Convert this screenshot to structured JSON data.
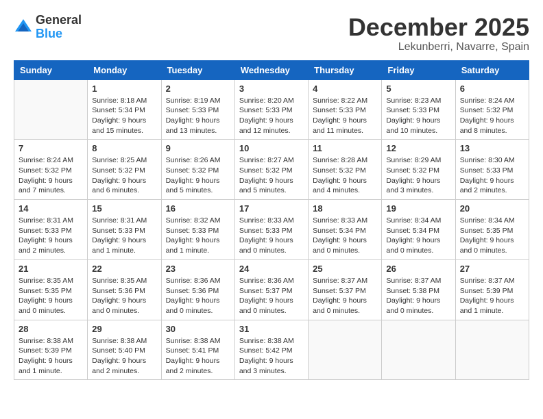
{
  "header": {
    "logo": {
      "general": "General",
      "blue": "Blue"
    },
    "month": "December 2025",
    "location": "Lekunberri, Navarre, Spain"
  },
  "days_of_week": [
    "Sunday",
    "Monday",
    "Tuesday",
    "Wednesday",
    "Thursday",
    "Friday",
    "Saturday"
  ],
  "weeks": [
    [
      {
        "day": "",
        "info": ""
      },
      {
        "day": "1",
        "info": "Sunrise: 8:18 AM\nSunset: 5:34 PM\nDaylight: 9 hours\nand 15 minutes."
      },
      {
        "day": "2",
        "info": "Sunrise: 8:19 AM\nSunset: 5:33 PM\nDaylight: 9 hours\nand 13 minutes."
      },
      {
        "day": "3",
        "info": "Sunrise: 8:20 AM\nSunset: 5:33 PM\nDaylight: 9 hours\nand 12 minutes."
      },
      {
        "day": "4",
        "info": "Sunrise: 8:22 AM\nSunset: 5:33 PM\nDaylight: 9 hours\nand 11 minutes."
      },
      {
        "day": "5",
        "info": "Sunrise: 8:23 AM\nSunset: 5:33 PM\nDaylight: 9 hours\nand 10 minutes."
      },
      {
        "day": "6",
        "info": "Sunrise: 8:24 AM\nSunset: 5:32 PM\nDaylight: 9 hours\nand 8 minutes."
      }
    ],
    [
      {
        "day": "7",
        "info": "Sunrise: 8:24 AM\nSunset: 5:32 PM\nDaylight: 9 hours\nand 7 minutes."
      },
      {
        "day": "8",
        "info": "Sunrise: 8:25 AM\nSunset: 5:32 PM\nDaylight: 9 hours\nand 6 minutes."
      },
      {
        "day": "9",
        "info": "Sunrise: 8:26 AM\nSunset: 5:32 PM\nDaylight: 9 hours\nand 5 minutes."
      },
      {
        "day": "10",
        "info": "Sunrise: 8:27 AM\nSunset: 5:32 PM\nDaylight: 9 hours\nand 5 minutes."
      },
      {
        "day": "11",
        "info": "Sunrise: 8:28 AM\nSunset: 5:32 PM\nDaylight: 9 hours\nand 4 minutes."
      },
      {
        "day": "12",
        "info": "Sunrise: 8:29 AM\nSunset: 5:32 PM\nDaylight: 9 hours\nand 3 minutes."
      },
      {
        "day": "13",
        "info": "Sunrise: 8:30 AM\nSunset: 5:33 PM\nDaylight: 9 hours\nand 2 minutes."
      }
    ],
    [
      {
        "day": "14",
        "info": "Sunrise: 8:31 AM\nSunset: 5:33 PM\nDaylight: 9 hours\nand 2 minutes."
      },
      {
        "day": "15",
        "info": "Sunrise: 8:31 AM\nSunset: 5:33 PM\nDaylight: 9 hours\nand 1 minute."
      },
      {
        "day": "16",
        "info": "Sunrise: 8:32 AM\nSunset: 5:33 PM\nDaylight: 9 hours\nand 1 minute."
      },
      {
        "day": "17",
        "info": "Sunrise: 8:33 AM\nSunset: 5:33 PM\nDaylight: 9 hours\nand 0 minutes."
      },
      {
        "day": "18",
        "info": "Sunrise: 8:33 AM\nSunset: 5:34 PM\nDaylight: 9 hours\nand 0 minutes."
      },
      {
        "day": "19",
        "info": "Sunrise: 8:34 AM\nSunset: 5:34 PM\nDaylight: 9 hours\nand 0 minutes."
      },
      {
        "day": "20",
        "info": "Sunrise: 8:34 AM\nSunset: 5:35 PM\nDaylight: 9 hours\nand 0 minutes."
      }
    ],
    [
      {
        "day": "21",
        "info": "Sunrise: 8:35 AM\nSunset: 5:35 PM\nDaylight: 9 hours\nand 0 minutes."
      },
      {
        "day": "22",
        "info": "Sunrise: 8:35 AM\nSunset: 5:36 PM\nDaylight: 9 hours\nand 0 minutes."
      },
      {
        "day": "23",
        "info": "Sunrise: 8:36 AM\nSunset: 5:36 PM\nDaylight: 9 hours\nand 0 minutes."
      },
      {
        "day": "24",
        "info": "Sunrise: 8:36 AM\nSunset: 5:37 PM\nDaylight: 9 hours\nand 0 minutes."
      },
      {
        "day": "25",
        "info": "Sunrise: 8:37 AM\nSunset: 5:37 PM\nDaylight: 9 hours\nand 0 minutes."
      },
      {
        "day": "26",
        "info": "Sunrise: 8:37 AM\nSunset: 5:38 PM\nDaylight: 9 hours\nand 0 minutes."
      },
      {
        "day": "27",
        "info": "Sunrise: 8:37 AM\nSunset: 5:39 PM\nDaylight: 9 hours\nand 1 minute."
      }
    ],
    [
      {
        "day": "28",
        "info": "Sunrise: 8:38 AM\nSunset: 5:39 PM\nDaylight: 9 hours\nand 1 minute."
      },
      {
        "day": "29",
        "info": "Sunrise: 8:38 AM\nSunset: 5:40 PM\nDaylight: 9 hours\nand 2 minutes."
      },
      {
        "day": "30",
        "info": "Sunrise: 8:38 AM\nSunset: 5:41 PM\nDaylight: 9 hours\nand 2 minutes."
      },
      {
        "day": "31",
        "info": "Sunrise: 8:38 AM\nSunset: 5:42 PM\nDaylight: 9 hours\nand 3 minutes."
      },
      {
        "day": "",
        "info": ""
      },
      {
        "day": "",
        "info": ""
      },
      {
        "day": "",
        "info": ""
      }
    ]
  ]
}
